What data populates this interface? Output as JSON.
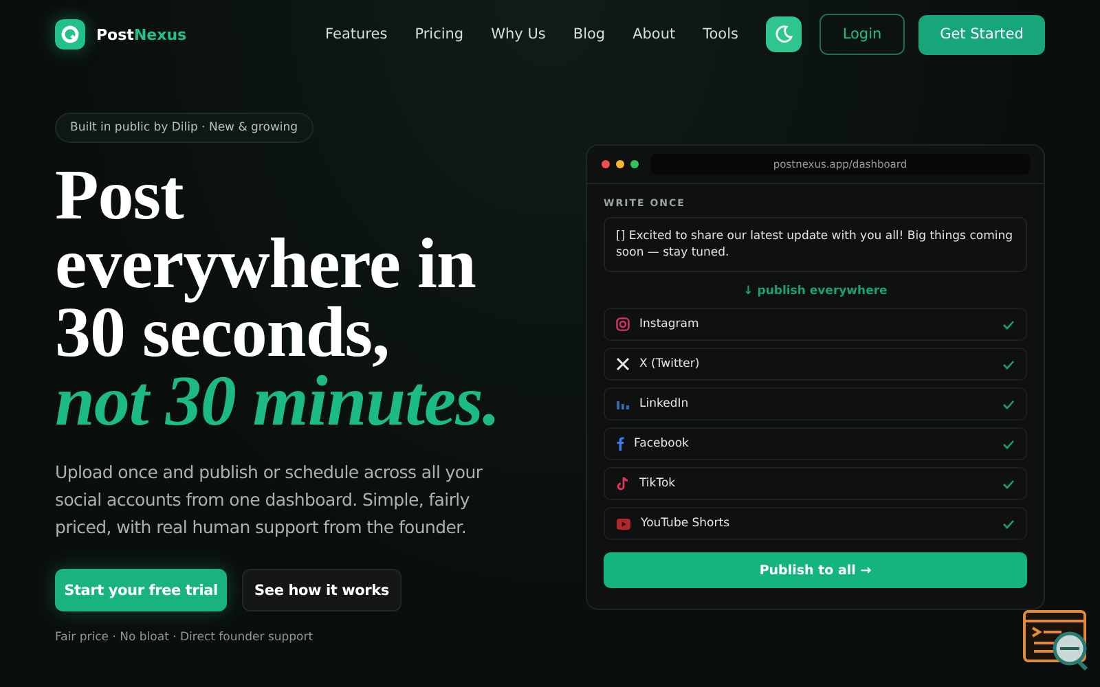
{
  "brand": {
    "first": "Post",
    "second": "Nexus"
  },
  "nav": {
    "links": [
      "Features",
      "Pricing",
      "Why Us",
      "Blog",
      "About",
      "Tools"
    ],
    "login": "Login",
    "cta": "Get Started"
  },
  "hero": {
    "badge": "Built in public by Dilip · New & growing",
    "title_lines": [
      "Post",
      "everywhere in",
      "30 seconds,"
    ],
    "title_accent": "not 30 minutes.",
    "lead": "Upload once and publish or schedule across all your social accounts from one dashboard. Simple, fairly priced, with real human support from the founder.",
    "primary": "Start your free trial",
    "secondary": "See how it works",
    "note": "Fair price · No bloat · Direct founder support"
  },
  "preview": {
    "url": "postnexus.app/dashboard",
    "section": "WRITE ONCE",
    "message": "[] Excited to share our latest update with you all! Big things coming soon — stay tuned.",
    "divider": "↓ publish everywhere",
    "platforms": [
      {
        "kind": "instagram",
        "name": "Instagram",
        "checked": true
      },
      {
        "kind": "x",
        "name": "X (Twitter)",
        "checked": true
      },
      {
        "kind": "linkedin",
        "name": "LinkedIn",
        "checked": true
      },
      {
        "kind": "facebook",
        "name": "Facebook",
        "checked": true
      },
      {
        "kind": "tiktok",
        "name": "TikTok",
        "checked": true
      },
      {
        "kind": "youtube",
        "name": "YouTube Shorts",
        "checked": true
      }
    ],
    "button": "Publish to all →"
  }
}
